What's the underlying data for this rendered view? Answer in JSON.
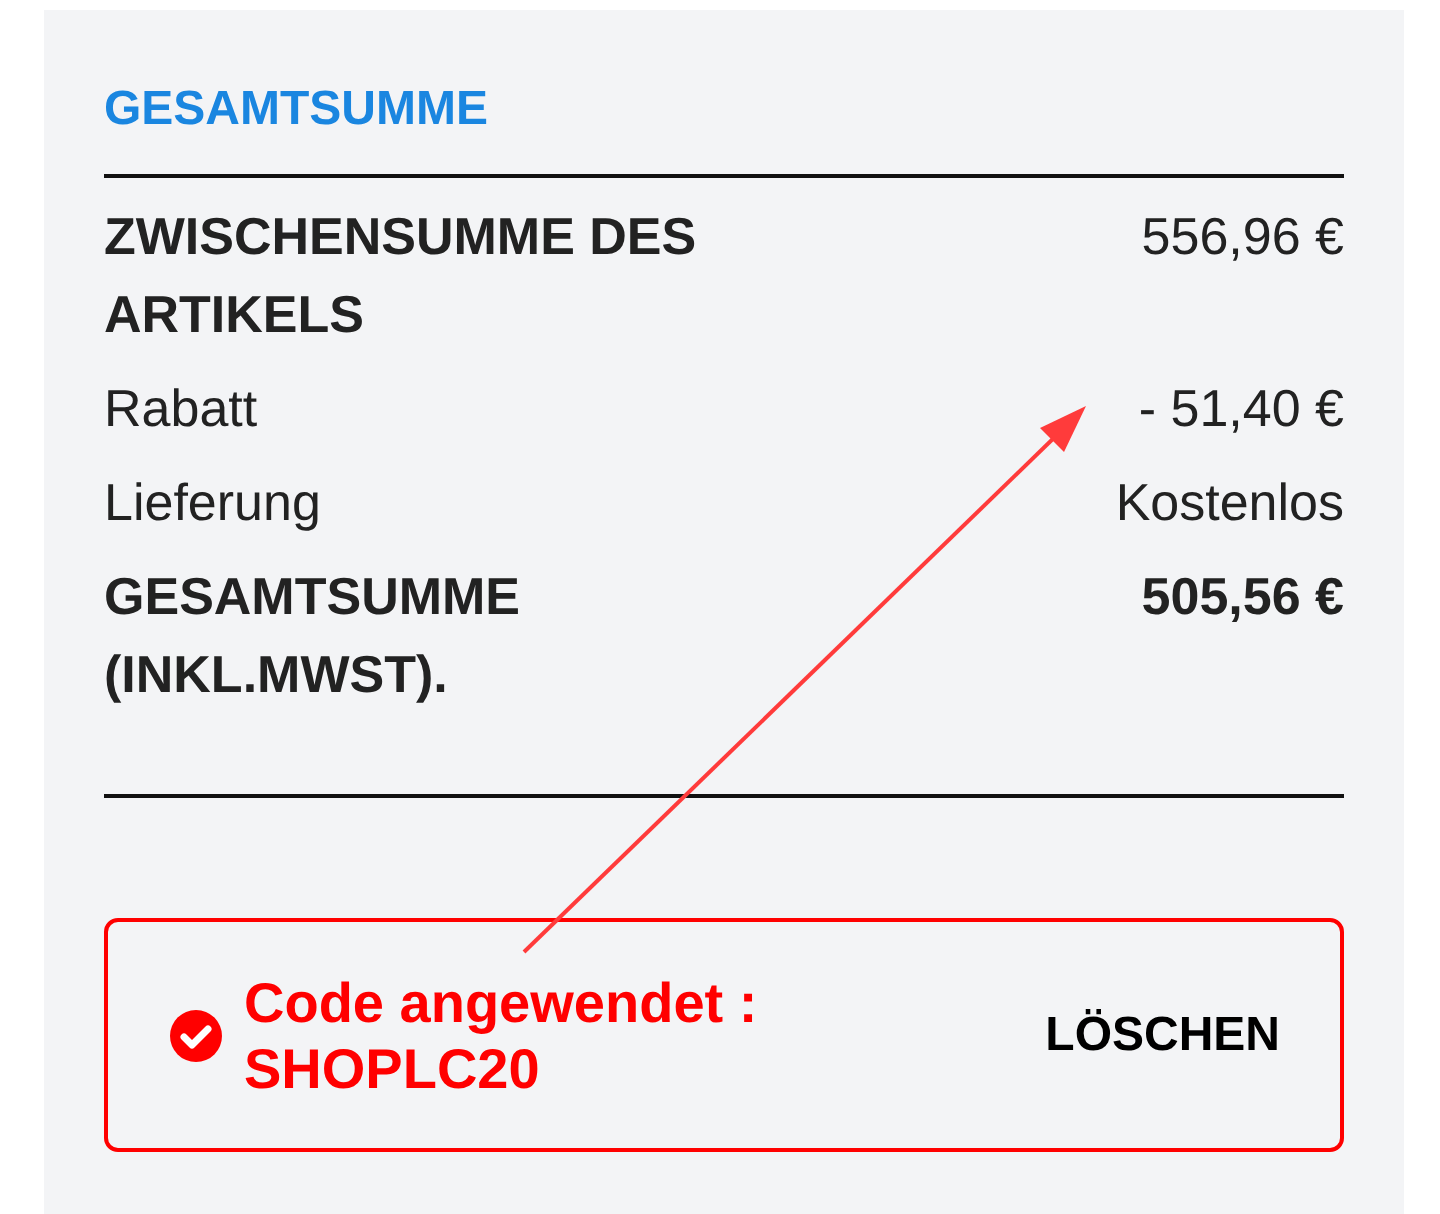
{
  "heading": "GESAMTSUMME",
  "rows": [
    {
      "kind": "subtotal",
      "label": "ZWISCHENSUMME DES ARTIKELS",
      "value": "556,96 €"
    },
    {
      "kind": "plain",
      "label": "Rabatt",
      "value": "- 51,40 €"
    },
    {
      "kind": "plain",
      "label": "Lieferung",
      "value": "Kostenlos"
    },
    {
      "kind": "strong",
      "label": "GESAMTSUMME (INKL.MWST).",
      "value": "505,56 €"
    }
  ],
  "coupon": {
    "applied": true,
    "message": "Code angewendet : SHOPLC20",
    "remove_button": "LÖSCHEN"
  },
  "annotation": {
    "kind": "arrow"
  }
}
